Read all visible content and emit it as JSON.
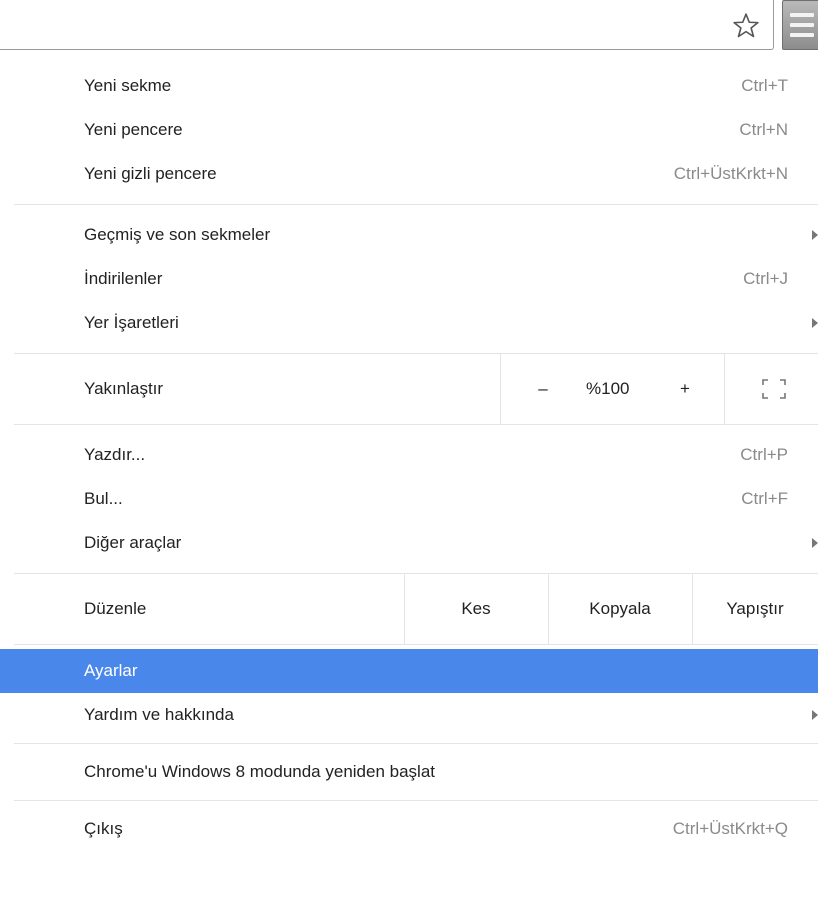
{
  "toolbar": {
    "star_icon": "star-icon",
    "menu_icon": "hamburger-menu-icon"
  },
  "menu": {
    "group1": [
      {
        "label": "Yeni sekme",
        "shortcut": "Ctrl+T"
      },
      {
        "label": "Yeni pencere",
        "shortcut": "Ctrl+N"
      },
      {
        "label": "Yeni gizli pencere",
        "shortcut": "Ctrl+ÜstKrkt+N"
      }
    ],
    "group2": [
      {
        "label": "Geçmiş ve son sekmeler",
        "shortcut": ""
      },
      {
        "label": "İndirilenler",
        "shortcut": "Ctrl+J"
      },
      {
        "label": "Yer İşaretleri",
        "shortcut": ""
      }
    ],
    "zoom": {
      "label": "Yakınlaştır",
      "minus": "–",
      "value": "%100",
      "plus": "+"
    },
    "group3": [
      {
        "label": "Yazdır...",
        "shortcut": "Ctrl+P"
      },
      {
        "label": "Bul...",
        "shortcut": "Ctrl+F"
      },
      {
        "label": "Diğer araçlar",
        "shortcut": ""
      }
    ],
    "edit": {
      "label": "Düzenle",
      "cut": "Kes",
      "copy": "Kopyala",
      "paste": "Yapıştır"
    },
    "settings": {
      "label": "Ayarlar"
    },
    "help": {
      "label": "Yardım ve hakkında"
    },
    "relaunch": {
      "label": "Chrome'u Windows 8 modunda yeniden başlat"
    },
    "exit": {
      "label": "Çıkış",
      "shortcut": "Ctrl+ÜstKrkt+Q"
    }
  },
  "colors": {
    "selected_bg": "#4a87ea",
    "shortcut_text": "#8a8a8a"
  }
}
